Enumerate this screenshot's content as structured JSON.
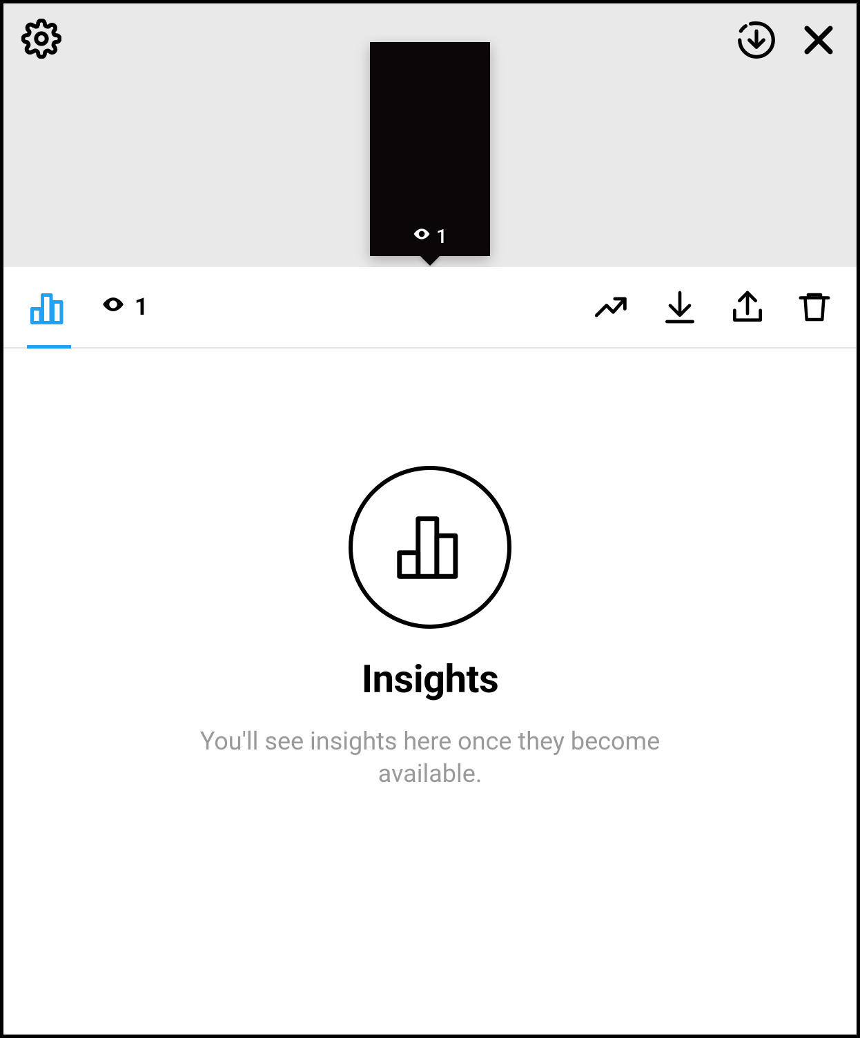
{
  "top": {
    "settings_icon": "gear-icon",
    "download_icon": "download-circle-icon",
    "close_icon": "close-icon"
  },
  "story_preview": {
    "views_count": "1"
  },
  "toolbar": {
    "insights_tab_icon": "bar-chart-icon",
    "viewers_count": "1",
    "promote_icon": "trend-up-icon",
    "download_icon": "download-icon",
    "share_icon": "share-icon",
    "delete_icon": "trash-icon"
  },
  "content": {
    "big_icon": "bar-chart-icon",
    "heading": "Insights",
    "subtext": "You'll see insights here once they become available."
  }
}
